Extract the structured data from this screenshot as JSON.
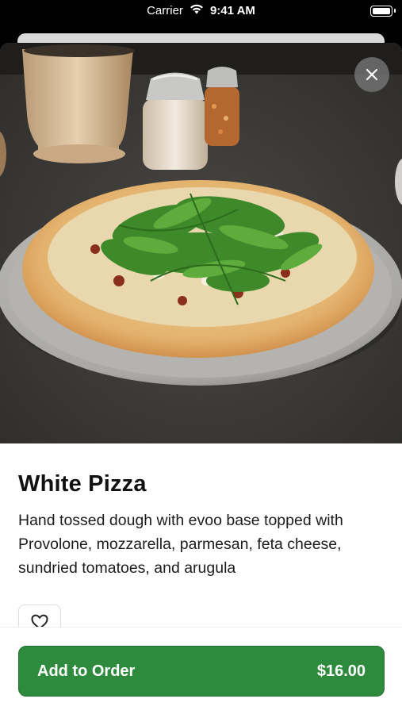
{
  "status_bar": {
    "carrier": "Carrier",
    "time": "9:41 AM"
  },
  "item": {
    "name": "White Pizza",
    "description": "Hand tossed dough with evoo base topped with Provolone, mozzarella, parmesan, feta cheese, sundried tomatoes, and arugula",
    "image_alt": "White pizza with arugula on a metal tray"
  },
  "actions": {
    "close_icon": "close-icon",
    "favorite_icon": "heart-outline-icon",
    "add_label": "Add to Order",
    "price": "$16.00"
  },
  "colors": {
    "primary_button": "#2e8a3c",
    "close_button": "#787878"
  }
}
